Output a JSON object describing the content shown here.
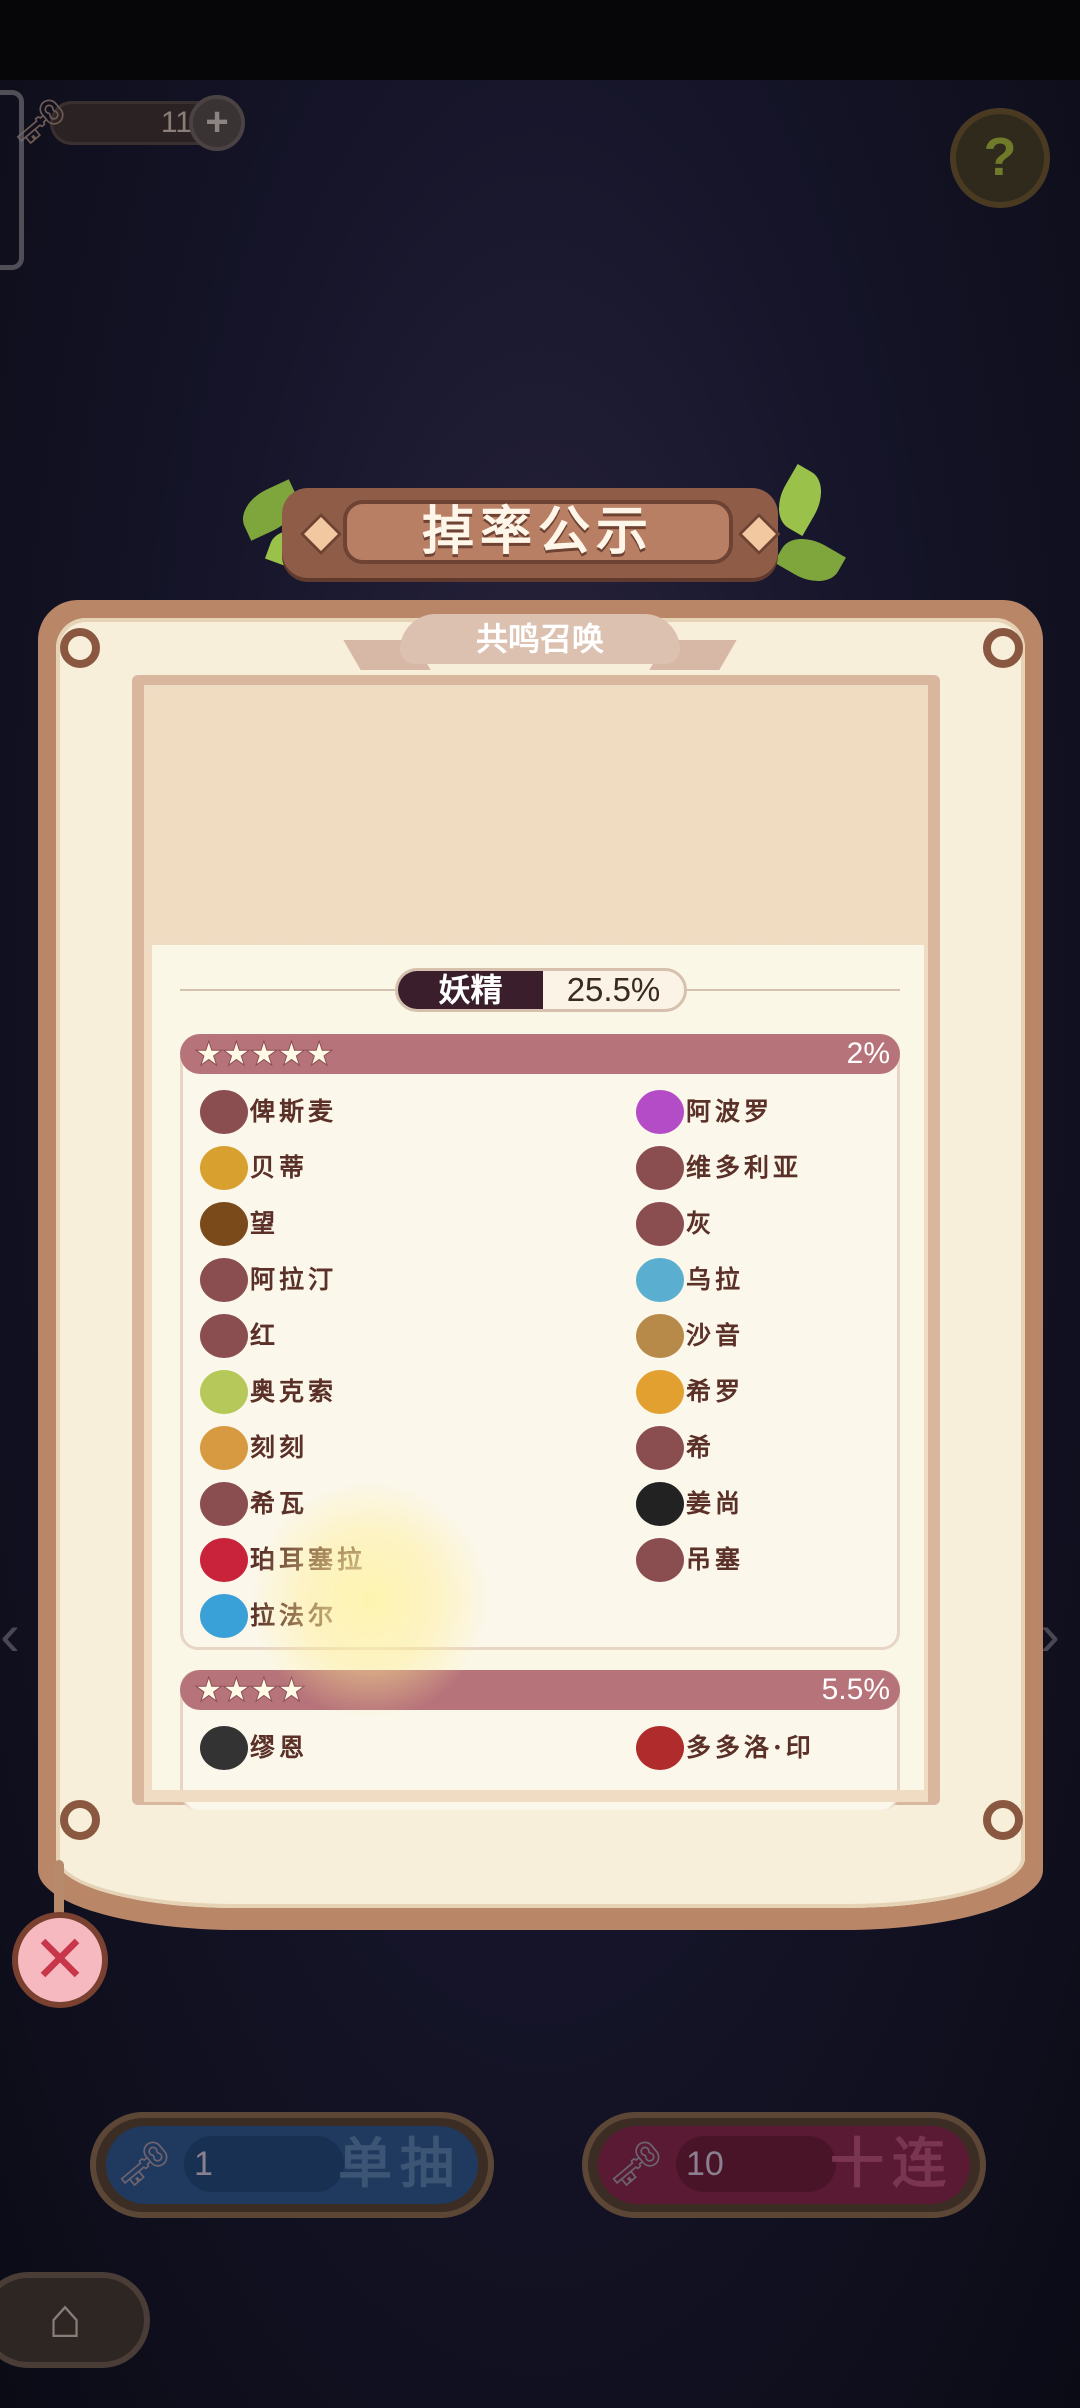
{
  "currency": {
    "count": "11",
    "plus_label": "+"
  },
  "help_label": "?",
  "dialog": {
    "title": "掉率公示",
    "subtitle": "共鸣召唤",
    "category": {
      "name": "妖精",
      "rate": "25.5%"
    },
    "tiers": [
      {
        "stars": "★★★★★",
        "rate": "2%",
        "items": [
          {
            "name": "俾斯麦",
            "icon": "blob-icon",
            "color": "#8a4e50"
          },
          {
            "name": "阿波罗",
            "icon": "purple-gem-icon",
            "color": "#b44cc7"
          },
          {
            "name": "贝蒂",
            "icon": "scissors-icon",
            "color": "#d8a02e"
          },
          {
            "name": "维多利亚",
            "icon": "blob-icon",
            "color": "#8a4e50"
          },
          {
            "name": "望",
            "icon": "telescope-icon",
            "color": "#7a4a1a"
          },
          {
            "name": "灰",
            "icon": "silhouette-icon",
            "color": "#8a4e50"
          },
          {
            "name": "阿拉汀",
            "icon": "silhouette-icon",
            "color": "#8a4e50"
          },
          {
            "name": "乌拉",
            "icon": "bottle-icon",
            "color": "#5aaed0"
          },
          {
            "name": "红",
            "icon": "bag-icon",
            "color": "#8a4e50"
          },
          {
            "name": "沙音",
            "icon": "birdcage-icon",
            "color": "#b88a4a"
          },
          {
            "name": "奥克索",
            "icon": "pinwheel-icon",
            "color": "#b6c85a"
          },
          {
            "name": "希罗",
            "icon": "crown-icon",
            "color": "#e2a030"
          },
          {
            "name": "刻刻",
            "icon": "pocket-watch-icon",
            "color": "#d89a40"
          },
          {
            "name": "希",
            "icon": "key-icon",
            "color": "#8a4e50"
          },
          {
            "name": "希瓦",
            "icon": "blob-icon",
            "color": "#8a4e50"
          },
          {
            "name": "姜尚",
            "icon": "yin-yang-icon",
            "color": "#222222"
          },
          {
            "name": "珀耳塞拉",
            "icon": "dice-icon",
            "color": "#c8233a"
          },
          {
            "name": "吊塞",
            "icon": "tile-icon",
            "color": "#8a4e50"
          },
          {
            "name": "拉法尔",
            "icon": "mirror-icon",
            "color": "#3aa0d8"
          }
        ]
      },
      {
        "stars": "★★★★",
        "rate": "5.5%",
        "items": [
          {
            "name": "缪恩",
            "icon": "chess-king-icon",
            "color": "#333333"
          },
          {
            "name": "多多洛·印",
            "icon": "ladle-icon",
            "color": "#b02c2c"
          }
        ]
      }
    ]
  },
  "buttons": {
    "single": {
      "count": "1",
      "label": "单抽",
      "color": "#2a5a9a"
    },
    "ten": {
      "count": "10",
      "label": "十连",
      "color": "#9a2a4a"
    },
    "close_symbol": "✕"
  }
}
